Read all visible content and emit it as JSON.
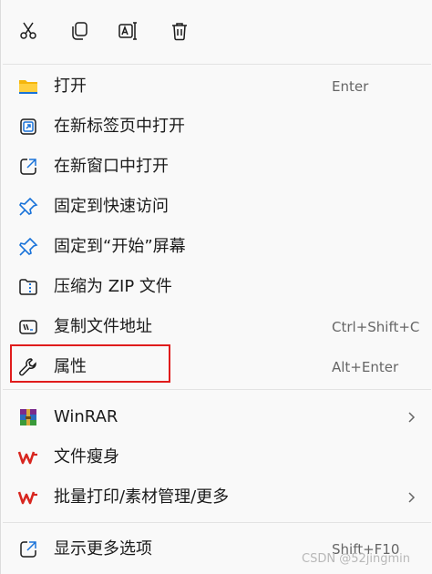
{
  "toolbar": {
    "icons": [
      "scissors-icon",
      "copy-icon",
      "rename-icon",
      "trash-icon"
    ]
  },
  "colors": {
    "accent_blue": "#1a73d9",
    "folder_yellow": "#f5b60c",
    "wps_red": "#d8261f",
    "highlight_red": "#e01c1c"
  },
  "items": [
    {
      "label": "打开",
      "shortcut": "Enter",
      "icon": "folder-icon"
    },
    {
      "label": "在新标签页中打开",
      "shortcut": "",
      "icon": "new-tab-icon"
    },
    {
      "label": "在新窗口中打开",
      "shortcut": "",
      "icon": "new-window-icon"
    },
    {
      "label": "固定到快速访问",
      "shortcut": "",
      "icon": "pin-icon"
    },
    {
      "label": "固定到“开始”屏幕",
      "shortcut": "",
      "icon": "pin-icon"
    },
    {
      "label": "压缩为 ZIP 文件",
      "shortcut": "",
      "icon": "zip-icon"
    },
    {
      "label": "复制文件地址",
      "shortcut": "Ctrl+Shift+C",
      "icon": "copy-path-icon"
    },
    {
      "label": "属性",
      "shortcut": "Alt+Enter",
      "icon": "wrench-icon"
    }
  ],
  "ext_items": [
    {
      "label": "WinRAR",
      "has_submenu": true,
      "icon": "winrar-icon"
    },
    {
      "label": "文件瘦身",
      "has_submenu": false,
      "icon": "wps-icon"
    },
    {
      "label": "批量打印/素材管理/更多",
      "has_submenu": true,
      "icon": "wps-icon"
    }
  ],
  "more": {
    "label": "显示更多选项",
    "shortcut": "Shift+F10",
    "icon": "more-options-icon"
  },
  "watermark": "CSDN @52jingmin"
}
